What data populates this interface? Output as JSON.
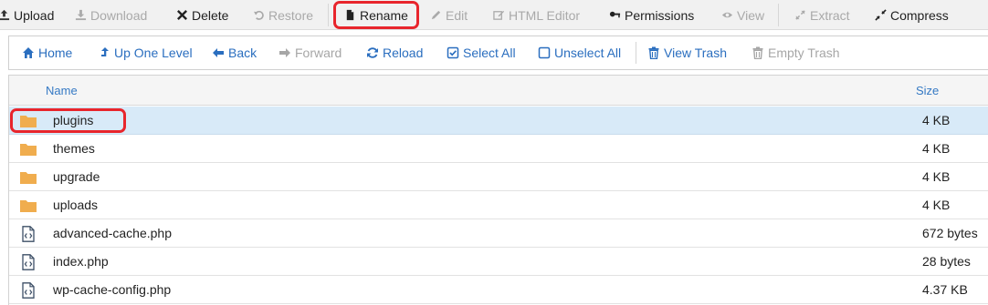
{
  "toolbar": {
    "upload": "Upload",
    "download": "Download",
    "delete": "Delete",
    "restore": "Restore",
    "rename": "Rename",
    "edit": "Edit",
    "html_editor": "HTML Editor",
    "permissions": "Permissions",
    "view": "View",
    "extract": "Extract",
    "compress": "Compress"
  },
  "nav": {
    "home": "Home",
    "up_one_level": "Up One Level",
    "back": "Back",
    "forward": "Forward",
    "reload": "Reload",
    "select_all": "Select All",
    "unselect_all": "Unselect All",
    "view_trash": "View Trash",
    "empty_trash": "Empty Trash"
  },
  "table": {
    "col_name": "Name",
    "col_size": "Size",
    "rows": [
      {
        "name": "plugins",
        "size": "4 KB",
        "type": "folder",
        "selected": true
      },
      {
        "name": "themes",
        "size": "4 KB",
        "type": "folder",
        "selected": false
      },
      {
        "name": "upgrade",
        "size": "4 KB",
        "type": "folder",
        "selected": false
      },
      {
        "name": "uploads",
        "size": "4 KB",
        "type": "folder",
        "selected": false
      },
      {
        "name": "advanced-cache.php",
        "size": "672 bytes",
        "type": "code-file",
        "selected": false
      },
      {
        "name": "index.php",
        "size": "28 bytes",
        "type": "code-file",
        "selected": false
      },
      {
        "name": "wp-cache-config.php",
        "size": "4.37 KB",
        "type": "code-file",
        "selected": false
      }
    ]
  },
  "colors": {
    "accent": "#2a6ebf",
    "folder": "#f0ad4e",
    "highlight": "#e8252c",
    "selected_row": "#d8eaf8"
  }
}
